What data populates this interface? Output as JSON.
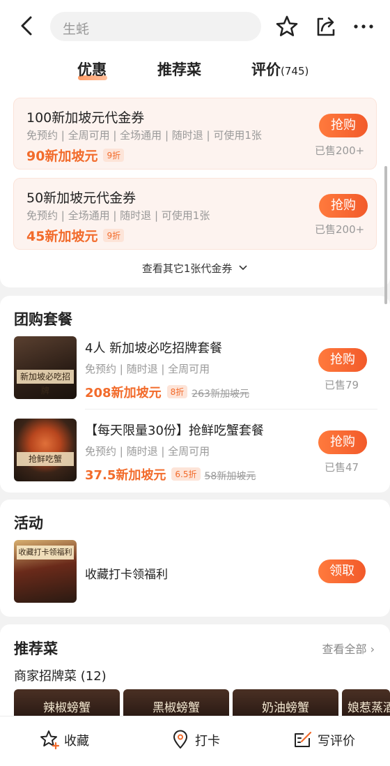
{
  "header": {
    "search_text": "生蚝",
    "tabs": [
      {
        "label": "优惠"
      },
      {
        "label": "推荐菜"
      },
      {
        "label": "评价",
        "count": "(745)"
      }
    ]
  },
  "vouchers": [
    {
      "title": "100新加坡元代金券",
      "tags": "免预约 | 全周可用 | 全场通用 | 随时退 | 可使用1张",
      "price": "90新加坡元",
      "discount": "9折",
      "button": "抢购",
      "sold": "已售200+"
    },
    {
      "title": "50新加坡元代金券",
      "tags": "免预约 | 全场通用 | 随时退 | 可使用1张",
      "price": "45新加坡元",
      "discount": "9折",
      "button": "抢购",
      "sold": "已售200+"
    }
  ],
  "voucher_more": "查看其它1张代金券",
  "group": {
    "title": "团购套餐",
    "items": [
      {
        "title": "4人 新加坡必吃招牌套餐",
        "tags": "免预约 | 随时退 | 全周可用",
        "price": "208新加坡元",
        "discount": "8折",
        "original": "263新加坡元",
        "button": "抢购",
        "sold": "已售79",
        "thumb_caption": "新加坡必吃招牌"
      },
      {
        "title": "【每天限量30份】抢鲜吃蟹套餐",
        "tags": "免预约 | 随时退 | 全周可用",
        "price": "37.5新加坡元",
        "discount": "6.5折",
        "original": "58新加坡元",
        "button": "抢购",
        "sold": "已售47",
        "thumb_caption": "抢鲜吃蟹"
      }
    ]
  },
  "activity": {
    "title": "活动",
    "item": {
      "text": "收藏打卡领福利",
      "button": "领取",
      "thumb_caption": "收藏打卡领福利"
    }
  },
  "recommend": {
    "title": "推荐菜",
    "see_all": "查看全部 ›",
    "subtitle": "商家招牌菜 (12)",
    "dishes": [
      "辣椒螃蟹",
      "黑椒螃蟹",
      "奶油螃蟹",
      "娘惹蒸酒"
    ]
  },
  "bottom_bar": [
    {
      "label": "收藏",
      "icon": "star-plus-icon"
    },
    {
      "label": "打卡",
      "icon": "location-pin-icon"
    },
    {
      "label": "写评价",
      "icon": "write-review-icon"
    }
  ],
  "colors": {
    "accent": "#f26b2b",
    "button_gradient_start": "#ff7a3d",
    "button_gradient_end": "#f25a2a"
  }
}
